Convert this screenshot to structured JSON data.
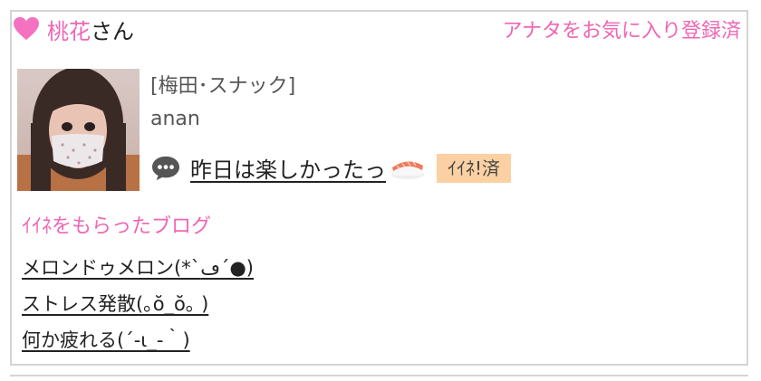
{
  "header": {
    "name": "桃花",
    "honorific": "さん",
    "favorite_status": "アナタをお気に入り登録済"
  },
  "profile": {
    "shop": "[梅田･スナック]",
    "handle": "anan",
    "avatar_icon": "profile-photo"
  },
  "latest_blog": {
    "title": "昨日は楽しかったっ",
    "icon": "speech-bubble-icon",
    "emoji": "sushi-icon",
    "like_badge": "ｲｲﾈ!済"
  },
  "liked_blogs": {
    "heading": "ｲｲﾈをもらったブログ",
    "items": [
      {
        "title": "メロンドゥメロン(*`ڡ´●)"
      },
      {
        "title": "ストレス発散(｡ŏ_ŏ｡ )"
      },
      {
        "title": "何か疲れる(´-ι_-｀)"
      }
    ]
  },
  "colors": {
    "accent_pink": "#f066b4",
    "badge_bg": "#fbd0a3",
    "border": "#d4d4d4"
  }
}
